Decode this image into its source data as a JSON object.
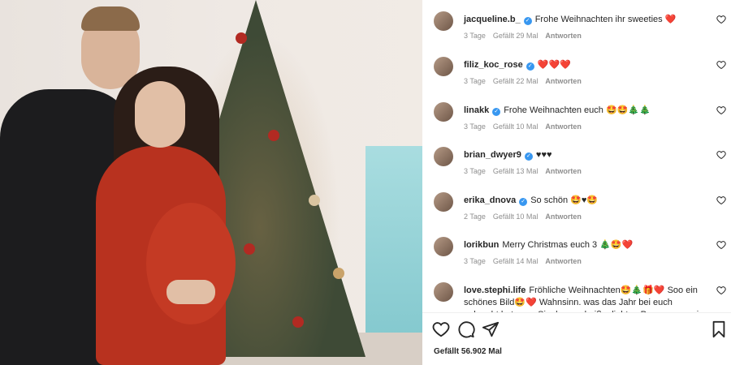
{
  "post": {
    "likes_label": "Gefällt 56.902 Mal"
  },
  "comments": [
    {
      "user": "jacqueline.b_",
      "verified": true,
      "text": "Frohe Weihnachten ihr sweeties ❤️",
      "age": "3 Tage",
      "likes": "Gefällt 29 Mal",
      "reply": "Antworten"
    },
    {
      "user": "filiz_koc_rose",
      "verified": true,
      "text": "❤️❤️❤️",
      "age": "3 Tage",
      "likes": "Gefällt 22 Mal",
      "reply": "Antworten"
    },
    {
      "user": "linakk",
      "verified": true,
      "text": "Frohe Weihnachten euch 🤩🤩🎄🎄",
      "age": "3 Tage",
      "likes": "Gefällt 10 Mal",
      "reply": "Antworten"
    },
    {
      "user": "brian_dwyer9",
      "verified": true,
      "text": "♥♥♥",
      "age": "3 Tage",
      "likes": "Gefällt 13 Mal",
      "reply": "Antworten"
    },
    {
      "user": "erika_dnova",
      "verified": true,
      "text": "So schön 🤩♥🤩",
      "age": "2 Tage",
      "likes": "Gefällt 10 Mal",
      "reply": "Antworten"
    },
    {
      "user": "lorikbun",
      "verified": false,
      "text": "Merry Christmas euch 3 🎄🤩❤️",
      "age": "3 Tage",
      "likes": "Gefällt 14 Mal",
      "reply": "Antworten"
    },
    {
      "user": "love.stephi.life",
      "verified": false,
      "text": "Fröhliche Weihnachten🤩🎄🎁❤️ Soo ein schönes Bild🤩❤️ Wahnsinn. was das Jahr bei euch gebracht hat, vom Single zum heißgeliebten Papa von zwei Kaiserprinzen",
      "age": "",
      "likes": "",
      "reply": ""
    }
  ],
  "icons": {
    "like": "heart-icon",
    "comment": "comment-icon",
    "share": "send-icon",
    "save": "bookmark-icon",
    "comment_like": "heart-outline-icon"
  },
  "colors": {
    "verified": "#3897f0",
    "meta": "#8e8e8e",
    "text": "#262626"
  }
}
